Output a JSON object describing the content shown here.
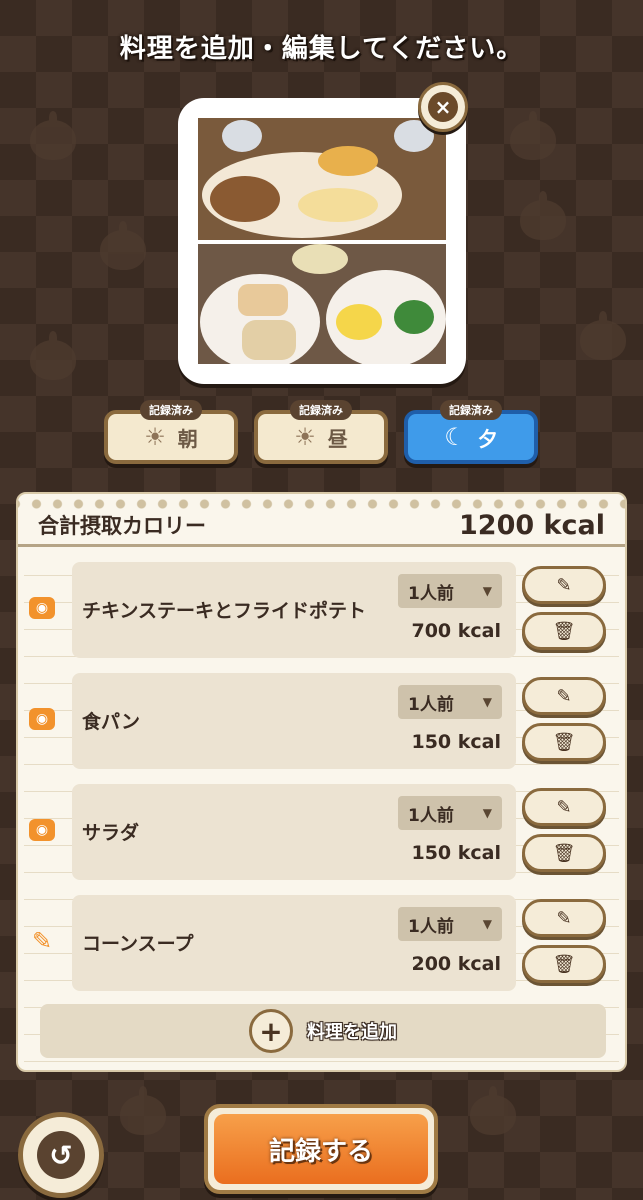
{
  "header": {
    "title": "料理を追加・編集してください。"
  },
  "photo_card": {
    "close_icon": "×"
  },
  "meals": [
    {
      "badge": "記録済み",
      "icon": "☀",
      "label": "朝",
      "active": false
    },
    {
      "badge": "記録済み",
      "icon": "☀",
      "label": "昼",
      "active": false
    },
    {
      "badge": "記録済み",
      "icon": "☾",
      "label": "夕",
      "active": true
    }
  ],
  "summary": {
    "label": "合計摂取カロリー",
    "total": "1200 kcal"
  },
  "items": [
    {
      "icon": "camera-icon",
      "name": "チキンステーキとフライドポテト",
      "serving": "1人前",
      "kcal": "700 kcal"
    },
    {
      "icon": "camera-icon",
      "name": "食パン",
      "serving": "1人前",
      "kcal": "150 kcal"
    },
    {
      "icon": "camera-icon",
      "name": "サラダ",
      "serving": "1人前",
      "kcal": "150 kcal"
    },
    {
      "icon": "pencil-icon",
      "name": "コーンスープ",
      "serving": "1人前",
      "kcal": "200 kcal"
    }
  ],
  "add_button": {
    "icon": "+",
    "label": "料理を追加"
  },
  "footer": {
    "back_icon": "↺",
    "record_label": "記録する"
  },
  "colors": {
    "accent_orange": "#ea6e1f",
    "active_blue": "#3f9bea",
    "frame_brown": "#8a6a3e"
  }
}
